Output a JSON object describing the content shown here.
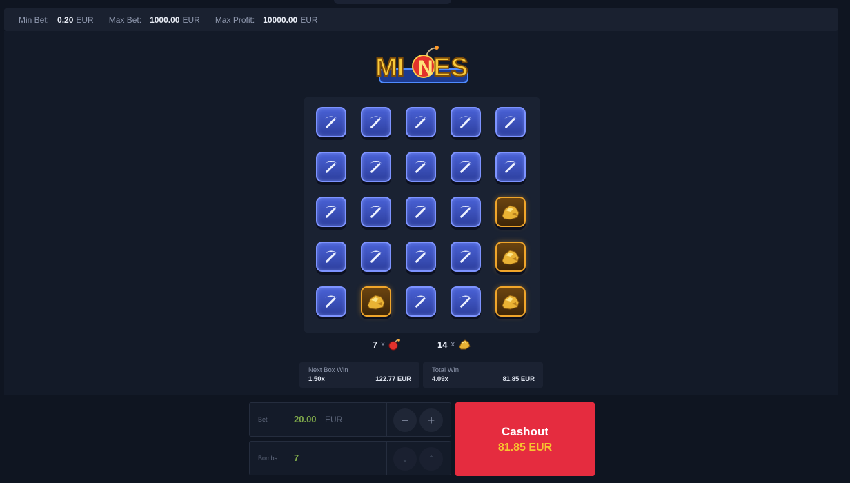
{
  "limits": {
    "min_bet_label": "Min Bet:",
    "min_bet_value": "0.20",
    "min_bet_currency": "EUR",
    "max_bet_label": "Max Bet:",
    "max_bet_value": "1000.00",
    "max_bet_currency": "EUR",
    "max_profit_label": "Max Profit:",
    "max_profit_value": "10000.00",
    "max_profit_currency": "EUR"
  },
  "logo": {
    "text_left": "MI",
    "text_mid": "N",
    "text_right": "ES"
  },
  "grid": {
    "rows": 5,
    "cols": 5,
    "tiles": [
      [
        "pickaxe",
        "pickaxe",
        "pickaxe",
        "pickaxe",
        "pickaxe"
      ],
      [
        "pickaxe",
        "pickaxe",
        "pickaxe",
        "pickaxe",
        "pickaxe"
      ],
      [
        "pickaxe",
        "pickaxe",
        "pickaxe",
        "pickaxe",
        "gold"
      ],
      [
        "pickaxe",
        "pickaxe",
        "pickaxe",
        "pickaxe",
        "gold"
      ],
      [
        "pickaxe",
        "gold",
        "pickaxe",
        "pickaxe",
        "gold"
      ]
    ]
  },
  "counts": {
    "bombs": "7",
    "bombs_x": "x",
    "gems": "14",
    "gems_x": "x"
  },
  "next_box_win": {
    "title": "Next Box Win",
    "multiplier": "1.50x",
    "amount": "122.77 EUR"
  },
  "total_win": {
    "title": "Total Win",
    "multiplier": "4.09x",
    "amount": "81.85 EUR"
  },
  "bet": {
    "label": "Bet",
    "value": "20.00",
    "currency": "EUR",
    "minus": "−",
    "plus": "+"
  },
  "bombs_ctrl": {
    "label": "Bombs",
    "value": "7",
    "down": "⌄",
    "up": "⌃"
  },
  "cashout": {
    "label": "Cashout",
    "amount": "81.85 EUR"
  },
  "colors": {
    "background": "#0f1521",
    "tile_blue": "#3a4fc0",
    "tile_gold_border": "#f0a52a",
    "cashout": "#e52c3f",
    "cashout_amount": "#f7c430",
    "bet_value": "#7ea84a"
  }
}
